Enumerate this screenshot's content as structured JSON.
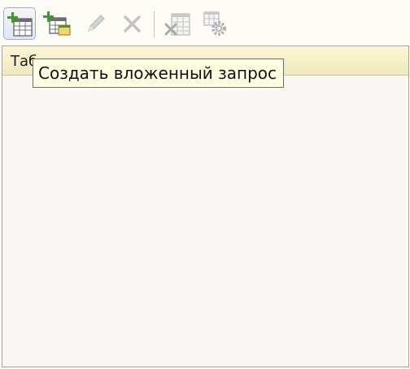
{
  "toolbar": {
    "buttons": [
      {
        "name": "add-table-button",
        "icon": "table-add-icon",
        "state": "active"
      },
      {
        "name": "add-nested-table-button",
        "icon": "table-nested-add-icon",
        "state": "enabled"
      },
      {
        "name": "edit-button",
        "icon": "pencil-icon",
        "state": "disabled"
      },
      {
        "name": "delete-button",
        "icon": "close-icon",
        "state": "disabled"
      },
      {
        "name": "delete-table-button",
        "icon": "table-delete-icon",
        "state": "disabled"
      },
      {
        "name": "table-settings-button",
        "icon": "table-gear-icon",
        "state": "disabled"
      }
    ]
  },
  "panel": {
    "header_label": "Таб"
  },
  "tooltip": {
    "text": "Создать вложенный запрос"
  },
  "colors": {
    "accent_green": "#3d9a2e",
    "header_bg": "#f3edc6",
    "tooltip_bg": "#ffffe1"
  }
}
